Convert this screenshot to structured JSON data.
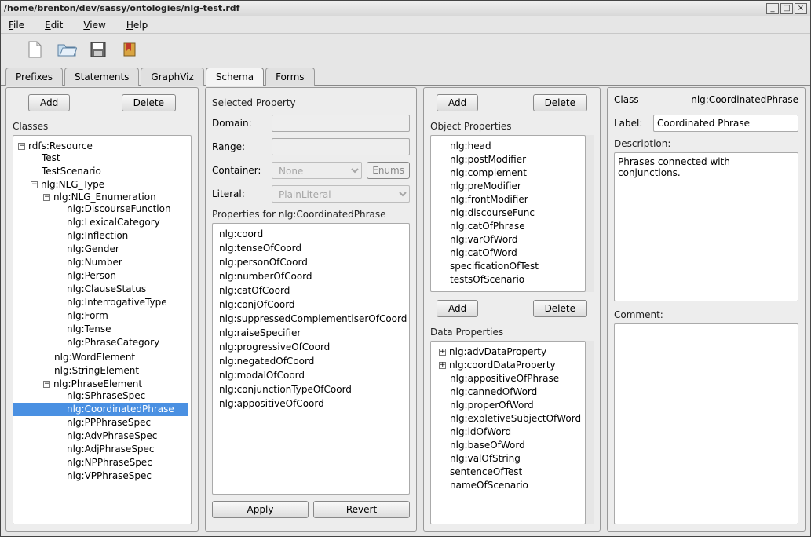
{
  "window": {
    "title": "/home/brenton/dev/sassy/ontologies/nlg-test.rdf"
  },
  "menubar": [
    "File",
    "Edit",
    "View",
    "Help"
  ],
  "tabs": [
    "Prefixes",
    "Statements",
    "GraphViz",
    "Schema",
    "Forms"
  ],
  "active_tab": "Schema",
  "panel1": {
    "add": "Add",
    "delete": "Delete",
    "classes_label": "Classes"
  },
  "tree": {
    "root": "rdfs:Resource",
    "n1": "Test",
    "n2": "TestScenario",
    "n3": "nlg:NLG_Type",
    "n3_1": "nlg:NLG_Enumeration",
    "enum": [
      "nlg:DiscourseFunction",
      "nlg:LexicalCategory",
      "nlg:Inflection",
      "nlg:Gender",
      "nlg:Number",
      "nlg:Person",
      "nlg:ClauseStatus",
      "nlg:InterrogativeType",
      "nlg:Form",
      "nlg:Tense",
      "nlg:PhraseCategory"
    ],
    "n3_2": "nlg:WordElement",
    "n3_3": "nlg:StringElement",
    "n3_4": "nlg:PhraseElement",
    "phrase": [
      "nlg:SPhraseSpec",
      "nlg:CoordinatedPhrase",
      "nlg:PPPhraseSpec",
      "nlg:AdvPhraseSpec",
      "nlg:AdjPhraseSpec",
      "nlg:NPPhraseSpec",
      "nlg:VPPhraseSpec"
    ]
  },
  "selected_node": "nlg:CoordinatedPhrase",
  "panel2": {
    "selected_property": "Selected Property",
    "domain": "Domain:",
    "range": "Range:",
    "container": "Container:",
    "container_val": "None",
    "enums": "Enums",
    "literal": "Literal:",
    "literal_val": "PlainLiteral",
    "properties_for": "Properties for nlg:CoordinatedPhrase",
    "props": [
      "nlg:coord",
      "nlg:tenseOfCoord",
      "nlg:personOfCoord",
      "nlg:numberOfCoord",
      "nlg:catOfCoord",
      "nlg:conjOfCoord",
      "nlg:suppressedComplementiserOfCoord",
      "nlg:raiseSpecifier",
      "nlg:progressiveOfCoord",
      "nlg:negatedOfCoord",
      "nlg:modalOfCoord",
      "nlg:conjunctionTypeOfCoord",
      "nlg:appositiveOfCoord"
    ],
    "apply": "Apply",
    "revert": "Revert"
  },
  "panel3": {
    "add": "Add",
    "delete": "Delete",
    "object_properties": "Object Properties",
    "obj_props": [
      "nlg:head",
      "nlg:postModifier",
      "nlg:complement",
      "nlg:preModifier",
      "nlg:frontModifier",
      "nlg:discourseFunc",
      "nlg:catOfPhrase",
      "nlg:varOfWord",
      "nlg:catOfWord",
      "specificationOfTest",
      "testsOfScenario"
    ],
    "add2": "Add",
    "delete2": "Delete",
    "data_properties": "Data Properties",
    "data_props_exp": [
      "nlg:advDataProperty",
      "nlg:coordDataProperty"
    ],
    "data_props": [
      "nlg:appositiveOfPhrase",
      "nlg:cannedOfWord",
      "nlg:properOfWord",
      "nlg:expletiveSubjectOfWord",
      "nlg:idOfWord",
      "nlg:baseOfWord",
      "nlg:valOfString",
      "sentenceOfTest",
      "nameOfScenario"
    ]
  },
  "panel4": {
    "class_label": "Class",
    "class_value": "nlg:CoordinatedPhrase",
    "label_label": "Label:",
    "label_value": "Coordinated Phrase",
    "description_label": "Description:",
    "description_value": "Phrases connected with conjunctions.",
    "comment_label": "Comment:"
  }
}
